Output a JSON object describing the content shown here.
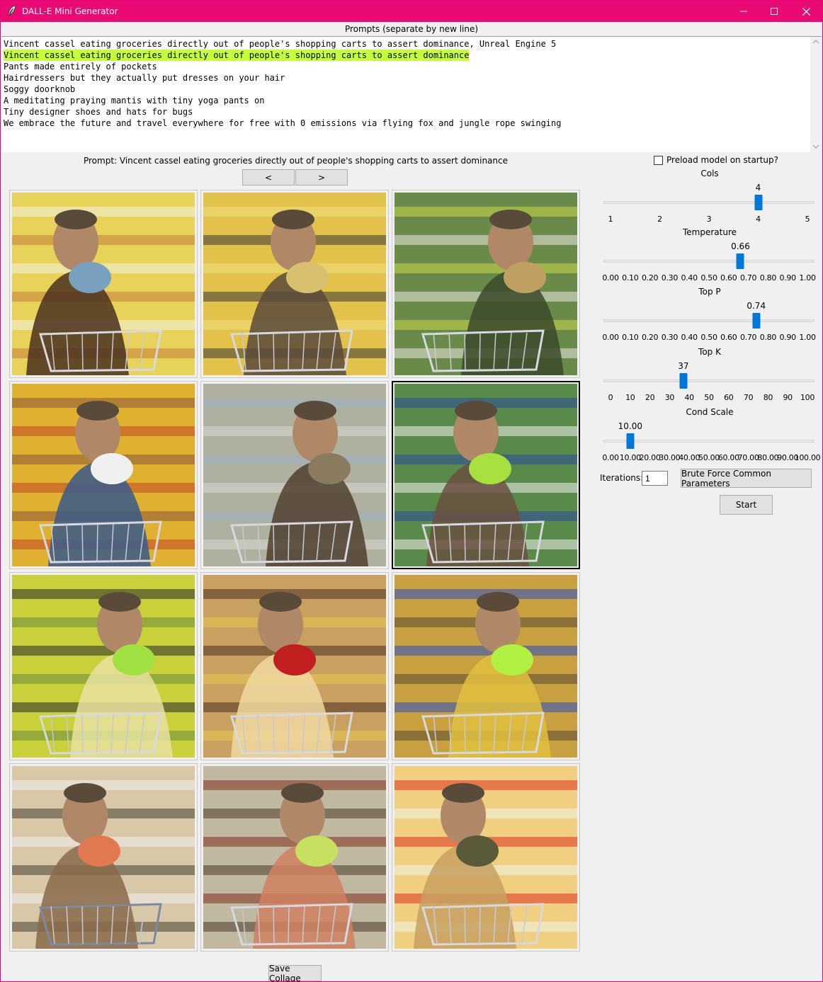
{
  "window": {
    "title": "DALL-E Mini Generator",
    "accent_color": "#ea0a73",
    "controls": [
      "minimize-icon",
      "maximize-icon",
      "close-icon"
    ]
  },
  "prompts": {
    "label": "Prompts (separate by new line)",
    "lines": [
      "Vincent cassel eating groceries directly out of people's shopping carts to assert dominance, Unreal Engine 5",
      "Vincent cassel eating groceries directly out of people's shopping carts to assert dominance",
      "Pants made entirely of pockets",
      "Hairdressers but they actually put dresses on your hair",
      "Soggy doorknob",
      "A meditating praying mantis with tiny yoga pants on",
      "Tiny designer shoes and hats for bugs",
      "We embrace the future and travel everywhere for free with 0 emissions via flying fox and jungle rope swinging"
    ],
    "selected_index": 1,
    "selection_color": "#c6ff3a"
  },
  "viewer": {
    "caption": "Prompt: Vincent cassel eating groceries directly out of people's shopping carts to assert dominance",
    "prev_label": "<",
    "next_label": ">",
    "rows": 4,
    "cols": 3,
    "active_image": 5,
    "save_label": "Save Collage"
  },
  "settings": {
    "preload_label": "Preload model on startup?",
    "preload_checked": false,
    "sliders": [
      {
        "id": "cols",
        "title": "Cols",
        "value": 4,
        "display": "4",
        "min": 1,
        "max": 5,
        "ticks": [
          "1",
          "2",
          "3",
          "4",
          "5"
        ]
      },
      {
        "id": "temperature",
        "title": "Temperature",
        "value": 0.66,
        "display": "0.66",
        "min": 0,
        "max": 1,
        "ticks": [
          "0.00",
          "0.10",
          "0.20",
          "0.30",
          "0.40",
          "0.50",
          "0.60",
          "0.70",
          "0.80",
          "0.90",
          "1.00"
        ]
      },
      {
        "id": "top-p",
        "title": "Top P",
        "value": 0.74,
        "display": "0.74",
        "min": 0,
        "max": 1,
        "ticks": [
          "0.00",
          "0.10",
          "0.20",
          "0.30",
          "0.40",
          "0.50",
          "0.60",
          "0.70",
          "0.80",
          "0.90",
          "1.00"
        ]
      },
      {
        "id": "top-k",
        "title": "Top K",
        "value": 37,
        "display": "37",
        "min": 0,
        "max": 100,
        "ticks": [
          "0",
          "10",
          "20",
          "30",
          "40",
          "50",
          "60",
          "70",
          "80",
          "90",
          "100"
        ]
      },
      {
        "id": "cond-scale",
        "title": "Cond Scale",
        "value": 10,
        "display": "10.00",
        "min": 0,
        "max": 100,
        "ticks": [
          "0.00",
          "10.00",
          "20.00",
          "30.00",
          "40.00",
          "50.00",
          "60.00",
          "70.00",
          "80.00",
          "90.00",
          "100.00"
        ]
      }
    ],
    "iterations_label": "Iterations:",
    "iterations_value": "1",
    "brute_force_label": "Brute Force Common Parameters",
    "start_label": "Start"
  }
}
